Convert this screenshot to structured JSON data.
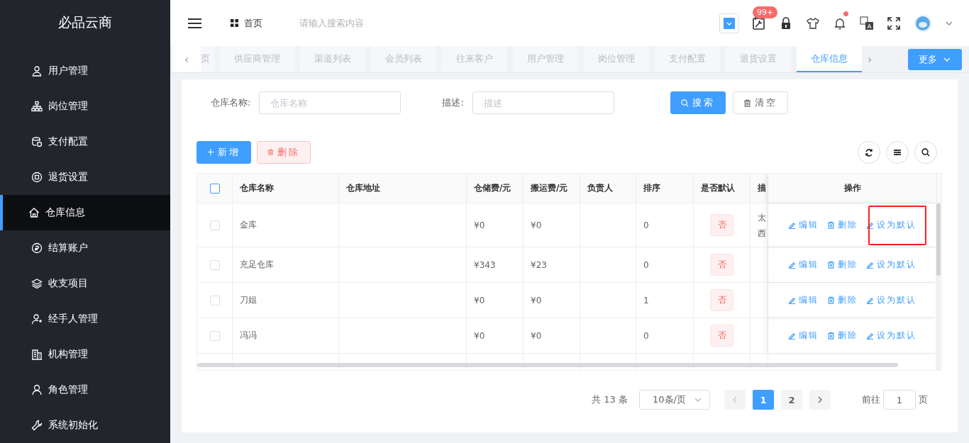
{
  "sidebar": {
    "brand": "必品云商",
    "items": [
      {
        "label": "用户管理",
        "selected": false
      },
      {
        "label": "岗位管理",
        "selected": false
      },
      {
        "label": "支付配置",
        "selected": false
      },
      {
        "label": "退货设置",
        "selected": false
      },
      {
        "label": "仓库信息",
        "selected": true
      },
      {
        "label": "结算账户",
        "selected": false
      },
      {
        "label": "收支项目",
        "selected": false
      },
      {
        "label": "经手人管理",
        "selected": false
      },
      {
        "label": "机构管理",
        "selected": false
      },
      {
        "label": "角色管理",
        "selected": false
      },
      {
        "label": "系统初始化",
        "selected": false
      }
    ]
  },
  "header": {
    "breadcrumb": "首页",
    "search_placeholder": "请输入搜索内容",
    "badge": "99+",
    "notification_dot": true
  },
  "tabs": {
    "prev": "‹",
    "next": "›",
    "more": "更多",
    "items": [
      {
        "label": "页",
        "selected": false
      },
      {
        "label": "供应商管理",
        "selected": false
      },
      {
        "label": "渠道列表",
        "selected": false
      },
      {
        "label": "会员列表",
        "selected": false
      },
      {
        "label": "往来客户",
        "selected": false
      },
      {
        "label": "用户管理",
        "selected": false
      },
      {
        "label": "岗位管理",
        "selected": false
      },
      {
        "label": "支付配置",
        "selected": false
      },
      {
        "label": "退货设置",
        "selected": false
      },
      {
        "label": "仓库信息",
        "selected": true
      }
    ]
  },
  "filters": [
    {
      "label": "仓库名称:",
      "placeholder": "仓库名称"
    },
    {
      "label": "描述:",
      "placeholder": "描述"
    }
  ],
  "filter_buttons": {
    "search": "搜索",
    "clear": "清空"
  },
  "toolbar": {
    "add": "新增",
    "delete": "删除"
  },
  "table": {
    "header_checked": false,
    "columns": [
      "仓库名称",
      "仓库地址",
      "仓储费/元",
      "搬运费/元",
      "负责人",
      "排序",
      "是否默认",
      "描",
      "操作"
    ],
    "rows": [
      {
        "checked": false,
        "name": "金库",
        "address": "",
        "storage_fee": "¥0",
        "handling_fee": "¥0",
        "manager": "",
        "order": "0",
        "default": "否",
        "description": [
          "太",
          "西"
        ],
        "actions": [
          "编辑",
          "删除",
          "设为默认"
        ],
        "highlighted": true
      },
      {
        "checked": false,
        "name": "充足仓库",
        "address": "",
        "storage_fee": "¥343",
        "handling_fee": "¥23",
        "manager": "",
        "order": "0",
        "default": "否",
        "description": [],
        "actions": [
          "编辑",
          "删除",
          "设为默认"
        ],
        "highlighted": false
      },
      {
        "checked": false,
        "name": "刀姐",
        "address": "",
        "storage_fee": "¥0",
        "handling_fee": "¥0",
        "manager": "",
        "order": "1",
        "default": "否",
        "description": [],
        "actions": [
          "编辑",
          "删除",
          "设为默认"
        ],
        "highlighted": false
      },
      {
        "checked": false,
        "name": "冯冯",
        "address": "",
        "storage_fee": "¥0",
        "handling_fee": "¥0",
        "manager": "",
        "order": "0",
        "default": "否",
        "description": [],
        "actions": [
          "编辑",
          "删除",
          "设为默认"
        ],
        "highlighted": false
      }
    ]
  },
  "pagination": {
    "total": "共 13 条",
    "page_size": "10条/页",
    "pages": [
      {
        "label": "1",
        "selected": true
      },
      {
        "label": "2",
        "selected": false
      }
    ],
    "prev_disabled": true,
    "goto_label": "前往",
    "goto_value": "1",
    "goto_suffix": "页"
  }
}
